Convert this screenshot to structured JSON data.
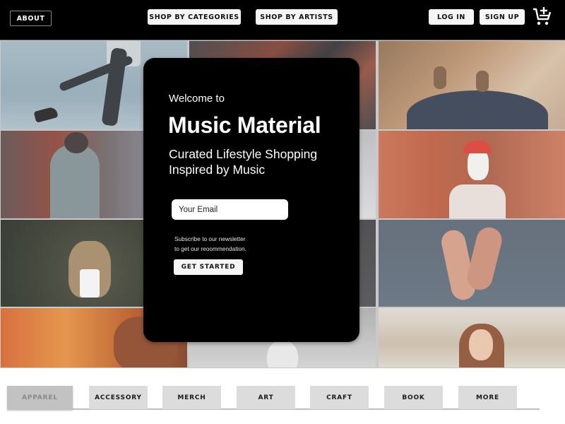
{
  "nav": {
    "about": "ABOUT",
    "shop_by_categories": "SHOP BY CATEGORIES",
    "shop_by_artists": "SHOP BY ARTISTS",
    "log_in": "LOG IN",
    "sign_up": "SIGN UP",
    "cart_icon": "add-to-cart-icon"
  },
  "hero": {
    "welcome": "Welcome to",
    "brand": "Music Material",
    "tagline": "Curated Lifestyle Shopping Inspired by Music",
    "email_placeholder": "Your Email",
    "email_value": "",
    "subscribe_line1": "Subscribe to our newsletter",
    "subscribe_line2": "to get our reoommendation.",
    "cta": "GET STARTED"
  },
  "gallery": {
    "tiles": [
      "woman-jumping-brick-wall",
      "leather-jackets",
      "feet-on-wooden-floor",
      "man-with-drum",
      "blurred-background",
      "woman-santa-hat-street",
      "curly-hair-woman-sunglasses",
      "dark-background",
      "raised-hands",
      "man-orange-light",
      "woman-black-and-white",
      "woman-hand-on-chin"
    ]
  },
  "categories": {
    "active_index": 0,
    "tabs": [
      "APPAREL",
      "ACCESSORY",
      "MERCH",
      "ART",
      "CRAFT",
      "BOOK",
      "MORE"
    ]
  },
  "colors": {
    "header_bg": "#000000",
    "card_bg": "#000000",
    "button_bg": "#f5f5f5",
    "tab_bg": "#dcdcdc",
    "tab_active_bg": "#c2c2c2"
  }
}
